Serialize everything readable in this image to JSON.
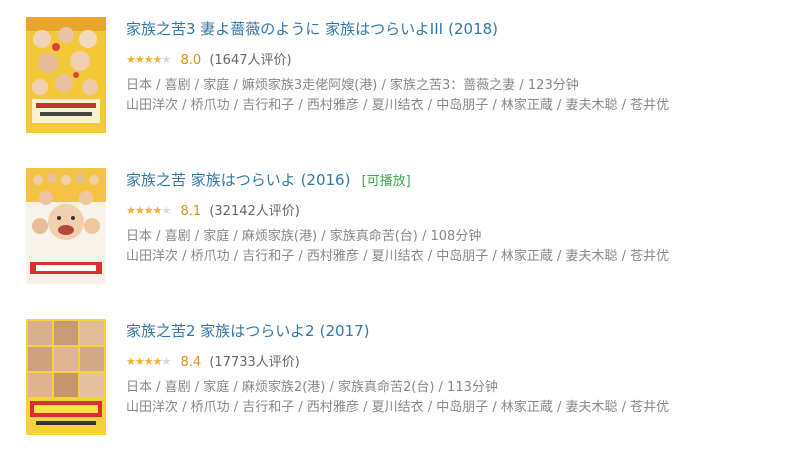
{
  "results": [
    {
      "title": "家族之苦3 妻よ薔薇のように 家族はつらいよIII",
      "year": "(2018)",
      "playable": "",
      "stars": [
        "★",
        "★",
        "★",
        "★",
        "★"
      ],
      "stars_filled": 4,
      "score": "8.0",
      "votes": "(1647人评价)",
      "info_line": "日本 / 喜剧 / 家庭 / 嫲烦家族3走佬阿嫂(港) / 家族之苦3：蔷薇之妻 / 123分钟",
      "cast_line": "山田洋次 / 桥爪功 / 吉行和子 / 西村雅彦 / 夏川结衣 / 中岛朋子 / 林家正蔵 / 妻夫木聪 / 苍井优"
    },
    {
      "title": "家族之苦 家族はつらいよ",
      "year": "(2016)",
      "playable": "[可播放]",
      "stars": [
        "★",
        "★",
        "★",
        "★",
        "★"
      ],
      "stars_filled": 4,
      "score": "8.1",
      "votes": "(32142人评价)",
      "info_line": "日本 / 喜剧 / 家庭 / 麻烦家族(港) / 家族真命苦(台) / 108分钟",
      "cast_line": "山田洋次 / 桥爪功 / 吉行和子 / 西村雅彦 / 夏川结衣 / 中岛朋子 / 林家正蔵 / 妻夫木聪 / 苍井优"
    },
    {
      "title": "家族之苦2 家族はつらいよ2",
      "year": "(2017)",
      "playable": "",
      "stars": [
        "★",
        "★",
        "★",
        "★",
        "★"
      ],
      "stars_filled": 4,
      "score": "8.4",
      "votes": "(17733人评价)",
      "info_line": "日本 / 喜剧 / 家庭 / 麻烦家族2(港) / 家族真命苦2(台) / 113分钟",
      "cast_line": "山田洋次 / 桥爪功 / 吉行和子 / 西村雅彦 / 夏川结衣 / 中岛朋子 / 林家正蔵 / 妻夫木聪 / 苍井优"
    }
  ],
  "colors": {
    "title": "#3377aa",
    "star": "#ffac2d",
    "score": "#e09015",
    "playable": "#3ba94d",
    "meta": "#888888"
  }
}
